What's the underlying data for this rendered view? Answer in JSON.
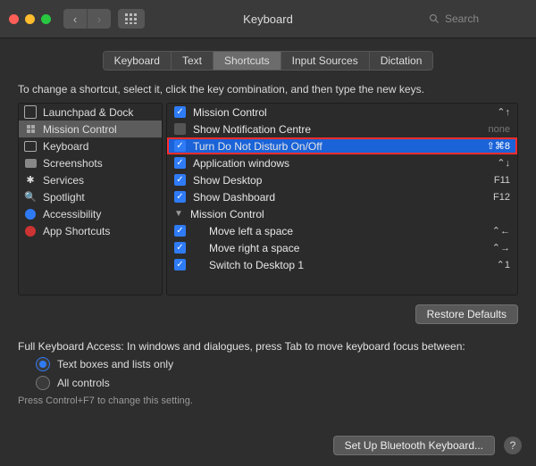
{
  "window": {
    "title": "Keyboard"
  },
  "search": {
    "placeholder": "Search"
  },
  "tabs": [
    {
      "label": "Keyboard"
    },
    {
      "label": "Text"
    },
    {
      "label": "Shortcuts",
      "active": true
    },
    {
      "label": "Input Sources"
    },
    {
      "label": "Dictation"
    }
  ],
  "instruction": "To change a shortcut, select it, click the key combination, and then type the new keys.",
  "categories": [
    {
      "label": "Launchpad & Dock",
      "icon": "launchpad"
    },
    {
      "label": "Mission Control",
      "icon": "mission-control",
      "selected": true
    },
    {
      "label": "Keyboard",
      "icon": "keyboard"
    },
    {
      "label": "Screenshots",
      "icon": "screenshots"
    },
    {
      "label": "Services",
      "icon": "services"
    },
    {
      "label": "Spotlight",
      "icon": "spotlight"
    },
    {
      "label": "Accessibility",
      "icon": "accessibility"
    },
    {
      "label": "App Shortcuts",
      "icon": "app-shortcuts"
    }
  ],
  "shortcuts": [
    {
      "label": "Mission Control",
      "checked": true,
      "key": "⌃↑"
    },
    {
      "label": "Show Notification Centre",
      "checked": false,
      "key": "none"
    },
    {
      "label": "Turn Do Not Disturb On/Off",
      "checked": true,
      "key": "⇧⌘8",
      "selected": true
    },
    {
      "label": "Application windows",
      "checked": true,
      "key": "⌃↓"
    },
    {
      "label": "Show Desktop",
      "checked": true,
      "key": "F11"
    },
    {
      "label": "Show Dashboard",
      "checked": true,
      "key": "F12"
    },
    {
      "label": "Mission Control",
      "group": true
    },
    {
      "label": "Move left a space",
      "checked": true,
      "key": "⌃←",
      "indent": true
    },
    {
      "label": "Move right a space",
      "checked": true,
      "key": "⌃→",
      "indent": true
    },
    {
      "label": "Switch to Desktop 1",
      "checked": true,
      "key": "⌃1",
      "indent": true
    }
  ],
  "restore_label": "Restore Defaults",
  "fka": {
    "text": "Full Keyboard Access: In windows and dialogues, press Tab to move keyboard focus between:",
    "opt1": "Text boxes and lists only",
    "opt2": "All controls",
    "hint": "Press Control+F7 to change this setting."
  },
  "footer": {
    "bluetooth": "Set Up Bluetooth Keyboard...",
    "help": "?"
  }
}
